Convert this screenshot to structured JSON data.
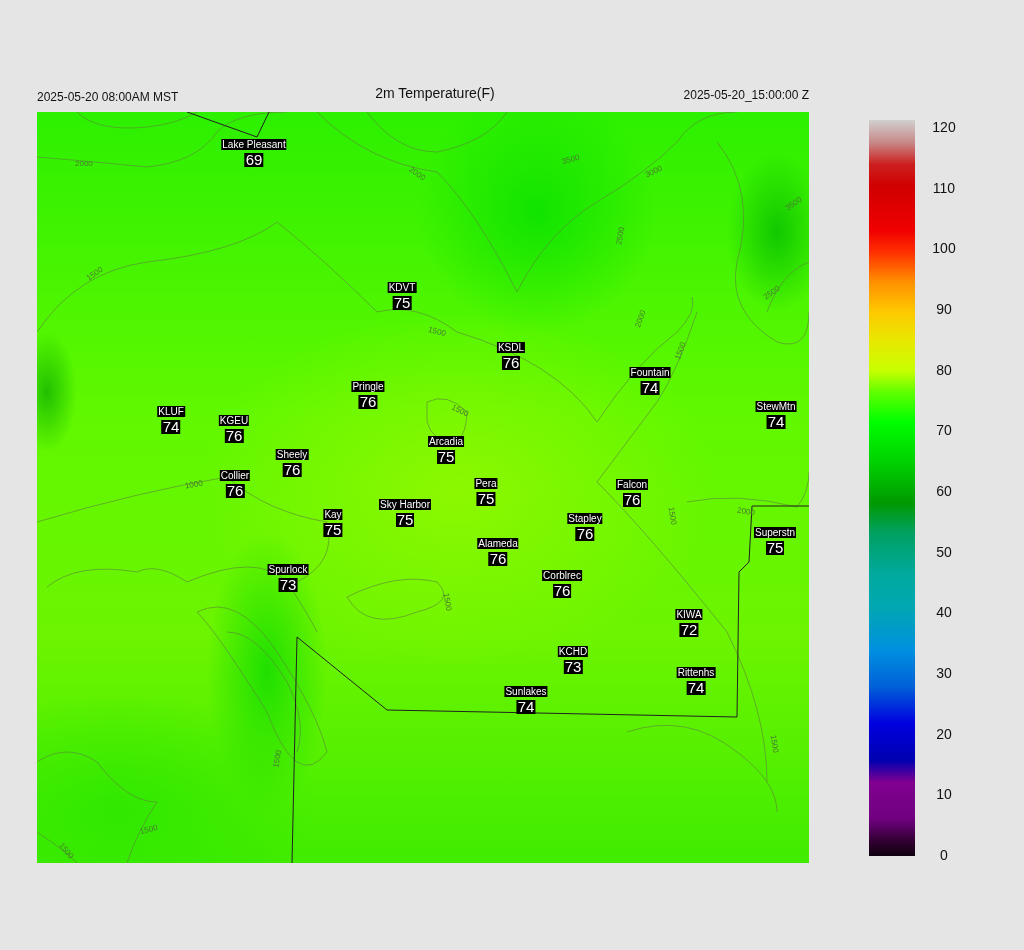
{
  "header": {
    "local_time": "2025-05-20 08:00AM MST",
    "title": "2m Temperature(F)",
    "utc_time": "2025-05-20_15:00:00 Z"
  },
  "stations": [
    {
      "name": "Lake Pleasant",
      "value": "69"
    },
    {
      "name": "KDVT",
      "value": "75"
    },
    {
      "name": "KSDL",
      "value": "76"
    },
    {
      "name": "Fountain",
      "value": "74"
    },
    {
      "name": "Pringle",
      "value": "76"
    },
    {
      "name": "KLUF",
      "value": "74"
    },
    {
      "name": "StewMtn",
      "value": "74"
    },
    {
      "name": "KGEU",
      "value": "76"
    },
    {
      "name": "Arcadia",
      "value": "75"
    },
    {
      "name": "Sheely",
      "value": "76"
    },
    {
      "name": "Collier",
      "value": "76"
    },
    {
      "name": "Pera",
      "value": "75"
    },
    {
      "name": "Falcon",
      "value": "76"
    },
    {
      "name": "Sky Harbor",
      "value": "75"
    },
    {
      "name": "Kay",
      "value": "75"
    },
    {
      "name": "Stapley",
      "value": "76"
    },
    {
      "name": "Superstn",
      "value": "75"
    },
    {
      "name": "Alameda",
      "value": "76"
    },
    {
      "name": "Spurlock",
      "value": "73"
    },
    {
      "name": "Corblrec",
      "value": "76"
    },
    {
      "name": "KIWA",
      "value": "72"
    },
    {
      "name": "KCHD",
      "value": "73"
    },
    {
      "name": "Rittenhs",
      "value": "74"
    },
    {
      "name": "Sunlakes",
      "value": "74"
    }
  ],
  "contour_labels": [
    "2000",
    "2000",
    "3500",
    "3000",
    "2500",
    "3500",
    "1500",
    "1500",
    "2500",
    "2000",
    "1500",
    "1500",
    "1000",
    "1500",
    "2000",
    "1500",
    "1500",
    "1500",
    "1500",
    "1500"
  ],
  "colorbar": {
    "ticks": [
      "120",
      "110",
      "100",
      "90",
      "80",
      "70",
      "60",
      "50",
      "40",
      "30",
      "20",
      "10",
      "0"
    ]
  }
}
